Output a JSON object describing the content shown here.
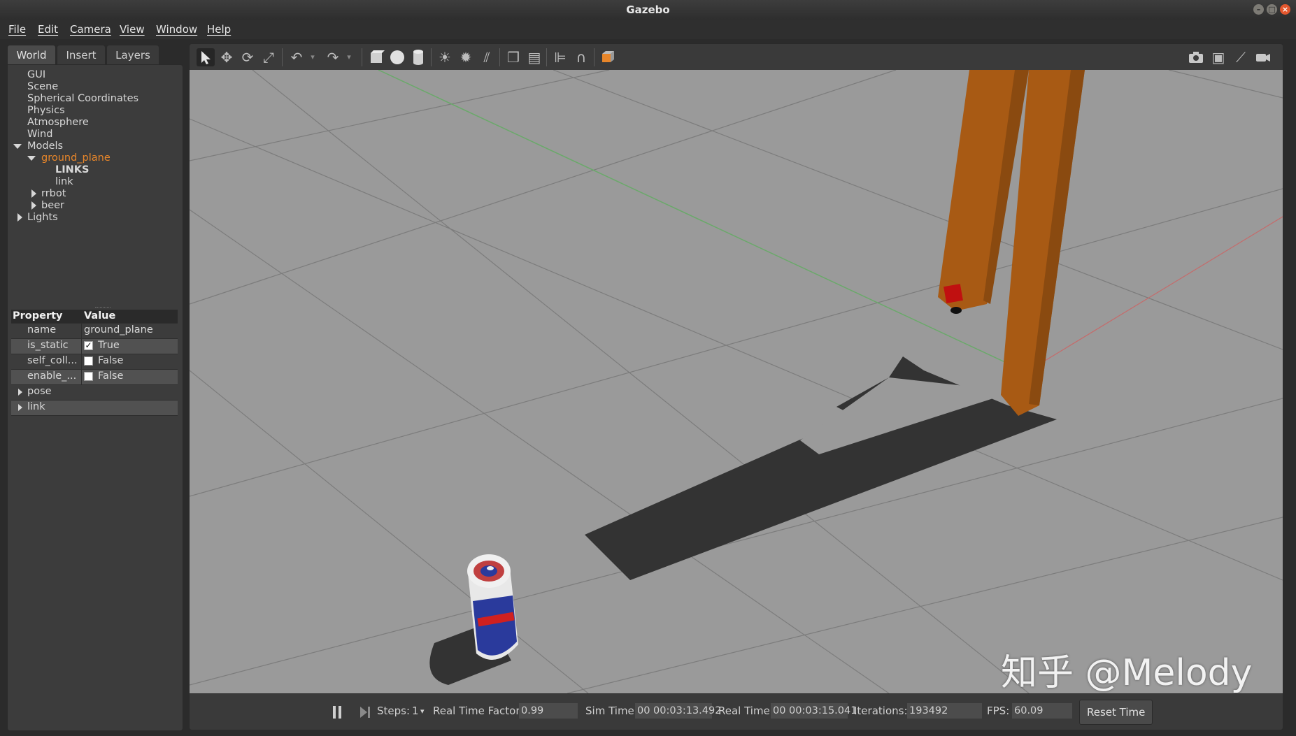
{
  "window": {
    "title": "Gazebo"
  },
  "menu": [
    "File",
    "Edit",
    "Camera",
    "View",
    "Window",
    "Help"
  ],
  "tabs": [
    "World",
    "Insert",
    "Layers"
  ],
  "tree": {
    "items": [
      "GUI",
      "Scene",
      "Spherical Coordinates",
      "Physics",
      "Atmosphere",
      "Wind"
    ],
    "models_label": "Models",
    "ground_plane": "ground_plane",
    "links_label": "LINKS",
    "link": "link",
    "rrbot": "rrbot",
    "beer": "beer",
    "lights_label": "Lights"
  },
  "properties": {
    "header_property": "Property",
    "header_value": "Value",
    "rows": [
      {
        "key": "name",
        "value": "ground_plane"
      },
      {
        "key": "is_static",
        "value": "True"
      },
      {
        "key": "self_coll...",
        "value": "False"
      },
      {
        "key": "enable_...",
        "value": "False"
      },
      {
        "key": "pose",
        "value": ""
      },
      {
        "key": "link",
        "value": ""
      }
    ]
  },
  "toolbar_icons": [
    "select-arrow-icon",
    "translate-icon",
    "rotate-icon",
    "scale-icon",
    "undo-icon",
    "redo-icon",
    "box-icon",
    "sphere-icon",
    "cylinder-icon",
    "point-light-icon",
    "spot-light-icon",
    "directional-light-icon",
    "copy-icon",
    "paste-icon",
    "align-icon",
    "snap-icon",
    "view-angle-icon",
    "screenshot-icon",
    "log-icon",
    "plot-icon",
    "record-video-icon"
  ],
  "status": {
    "steps_label": "Steps:",
    "steps_value": "1",
    "rtf_label": "Real Time Factor:",
    "rtf_value": "0.99",
    "sim_time_label": "Sim Time:",
    "sim_time_value": "00 00:03:13.492",
    "real_time_label": "Real Time:",
    "real_time_value": "00 00:03:15.041",
    "iterations_label": "Iterations:",
    "iterations_value": "193492",
    "fps_label": "FPS:",
    "fps_value": "60.09",
    "reset_label": "Reset Time"
  },
  "watermark": "知乎 @Melody",
  "colors": {
    "selected": "#e8862a",
    "ground": "#9a9a9a",
    "robot_arm": "#a85a14",
    "shadow": "#333333"
  }
}
